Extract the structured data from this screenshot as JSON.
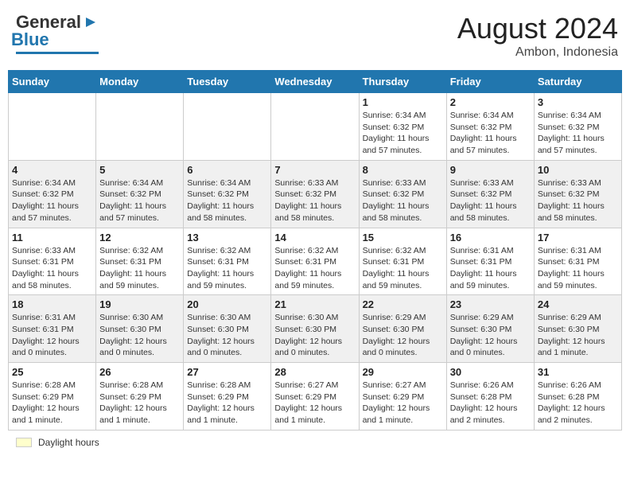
{
  "header": {
    "logo_gen": "General",
    "logo_blue": "Blue",
    "main_title": "August 2024",
    "subtitle": "Ambon, Indonesia"
  },
  "days_of_week": [
    "Sunday",
    "Monday",
    "Tuesday",
    "Wednesday",
    "Thursday",
    "Friday",
    "Saturday"
  ],
  "weeks": [
    [
      {
        "day": "",
        "info": ""
      },
      {
        "day": "",
        "info": ""
      },
      {
        "day": "",
        "info": ""
      },
      {
        "day": "",
        "info": ""
      },
      {
        "day": "1",
        "info": "Sunrise: 6:34 AM\nSunset: 6:32 PM\nDaylight: 11 hours and 57 minutes."
      },
      {
        "day": "2",
        "info": "Sunrise: 6:34 AM\nSunset: 6:32 PM\nDaylight: 11 hours and 57 minutes."
      },
      {
        "day": "3",
        "info": "Sunrise: 6:34 AM\nSunset: 6:32 PM\nDaylight: 11 hours and 57 minutes."
      }
    ],
    [
      {
        "day": "4",
        "info": "Sunrise: 6:34 AM\nSunset: 6:32 PM\nDaylight: 11 hours and 57 minutes."
      },
      {
        "day": "5",
        "info": "Sunrise: 6:34 AM\nSunset: 6:32 PM\nDaylight: 11 hours and 57 minutes."
      },
      {
        "day": "6",
        "info": "Sunrise: 6:34 AM\nSunset: 6:32 PM\nDaylight: 11 hours and 58 minutes."
      },
      {
        "day": "7",
        "info": "Sunrise: 6:33 AM\nSunset: 6:32 PM\nDaylight: 11 hours and 58 minutes."
      },
      {
        "day": "8",
        "info": "Sunrise: 6:33 AM\nSunset: 6:32 PM\nDaylight: 11 hours and 58 minutes."
      },
      {
        "day": "9",
        "info": "Sunrise: 6:33 AM\nSunset: 6:32 PM\nDaylight: 11 hours and 58 minutes."
      },
      {
        "day": "10",
        "info": "Sunrise: 6:33 AM\nSunset: 6:32 PM\nDaylight: 11 hours and 58 minutes."
      }
    ],
    [
      {
        "day": "11",
        "info": "Sunrise: 6:33 AM\nSunset: 6:31 PM\nDaylight: 11 hours and 58 minutes."
      },
      {
        "day": "12",
        "info": "Sunrise: 6:32 AM\nSunset: 6:31 PM\nDaylight: 11 hours and 59 minutes."
      },
      {
        "day": "13",
        "info": "Sunrise: 6:32 AM\nSunset: 6:31 PM\nDaylight: 11 hours and 59 minutes."
      },
      {
        "day": "14",
        "info": "Sunrise: 6:32 AM\nSunset: 6:31 PM\nDaylight: 11 hours and 59 minutes."
      },
      {
        "day": "15",
        "info": "Sunrise: 6:32 AM\nSunset: 6:31 PM\nDaylight: 11 hours and 59 minutes."
      },
      {
        "day": "16",
        "info": "Sunrise: 6:31 AM\nSunset: 6:31 PM\nDaylight: 11 hours and 59 minutes."
      },
      {
        "day": "17",
        "info": "Sunrise: 6:31 AM\nSunset: 6:31 PM\nDaylight: 11 hours and 59 minutes."
      }
    ],
    [
      {
        "day": "18",
        "info": "Sunrise: 6:31 AM\nSunset: 6:31 PM\nDaylight: 12 hours and 0 minutes."
      },
      {
        "day": "19",
        "info": "Sunrise: 6:30 AM\nSunset: 6:30 PM\nDaylight: 12 hours and 0 minutes."
      },
      {
        "day": "20",
        "info": "Sunrise: 6:30 AM\nSunset: 6:30 PM\nDaylight: 12 hours and 0 minutes."
      },
      {
        "day": "21",
        "info": "Sunrise: 6:30 AM\nSunset: 6:30 PM\nDaylight: 12 hours and 0 minutes."
      },
      {
        "day": "22",
        "info": "Sunrise: 6:29 AM\nSunset: 6:30 PM\nDaylight: 12 hours and 0 minutes."
      },
      {
        "day": "23",
        "info": "Sunrise: 6:29 AM\nSunset: 6:30 PM\nDaylight: 12 hours and 0 minutes."
      },
      {
        "day": "24",
        "info": "Sunrise: 6:29 AM\nSunset: 6:30 PM\nDaylight: 12 hours and 1 minute."
      }
    ],
    [
      {
        "day": "25",
        "info": "Sunrise: 6:28 AM\nSunset: 6:29 PM\nDaylight: 12 hours and 1 minute."
      },
      {
        "day": "26",
        "info": "Sunrise: 6:28 AM\nSunset: 6:29 PM\nDaylight: 12 hours and 1 minute."
      },
      {
        "day": "27",
        "info": "Sunrise: 6:28 AM\nSunset: 6:29 PM\nDaylight: 12 hours and 1 minute."
      },
      {
        "day": "28",
        "info": "Sunrise: 6:27 AM\nSunset: 6:29 PM\nDaylight: 12 hours and 1 minute."
      },
      {
        "day": "29",
        "info": "Sunrise: 6:27 AM\nSunset: 6:29 PM\nDaylight: 12 hours and 1 minute."
      },
      {
        "day": "30",
        "info": "Sunrise: 6:26 AM\nSunset: 6:28 PM\nDaylight: 12 hours and 2 minutes."
      },
      {
        "day": "31",
        "info": "Sunrise: 6:26 AM\nSunset: 6:28 PM\nDaylight: 12 hours and 2 minutes."
      }
    ]
  ],
  "legend": {
    "daylight_label": "Daylight hours"
  }
}
